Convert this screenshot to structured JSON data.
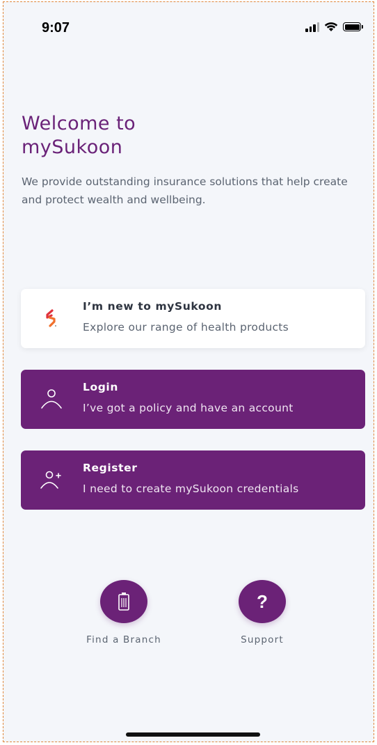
{
  "status_bar": {
    "time": "9:07"
  },
  "welcome": {
    "title_line1": "Welcome to",
    "title_line2": "mySukoon",
    "subtitle": "We provide outstanding insurance solutions that help create and protect wealth and wellbeing."
  },
  "options": {
    "new_user": {
      "title": "I’m new to mySukoon",
      "description": "Explore our range of health products",
      "icon": "sukoon-logo-icon"
    },
    "login": {
      "title": "Login",
      "description": "I’ve got a policy and have an account",
      "icon": "user-icon"
    },
    "register": {
      "title": "Register",
      "description": "I need to create mySukoon credentials",
      "icon": "add-user-icon"
    }
  },
  "bottom_actions": {
    "find_branch": {
      "label": "Find a Branch",
      "icon": "building-icon"
    },
    "support": {
      "label": "Support",
      "icon": "question-icon",
      "symbol": "?"
    }
  },
  "colors": {
    "brand_purple": "#6b2277",
    "title_purple": "#6a2278",
    "background": "#f4f6fa",
    "logo_orange": "#f0702d",
    "logo_red": "#e0323c"
  }
}
